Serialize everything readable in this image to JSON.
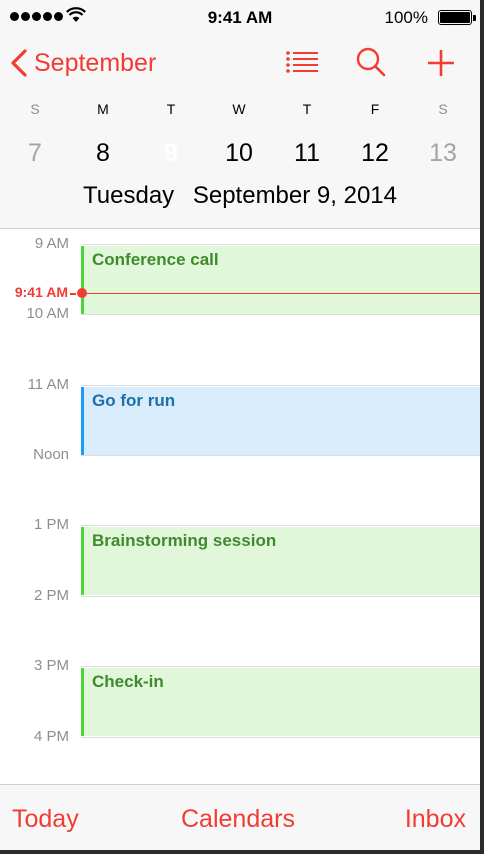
{
  "status_bar": {
    "time": "9:41 AM",
    "battery": "100%"
  },
  "nav": {
    "back_label": "September"
  },
  "week": {
    "weekdays": [
      "S",
      "M",
      "T",
      "W",
      "T",
      "F",
      "S"
    ],
    "dates": [
      "7",
      "8",
      "9",
      "10",
      "11",
      "12",
      "13"
    ],
    "selected_index": 2
  },
  "selected_day": {
    "weekday": "Tuesday",
    "date": "September 9, 2014"
  },
  "timeline": {
    "hours": [
      "9 AM",
      "10 AM",
      "11 AM",
      "Noon",
      "1 PM",
      "2 PM",
      "3 PM",
      "4 PM"
    ],
    "now_label": "9:41 AM",
    "events": [
      {
        "title": "Conference call",
        "color": "green"
      },
      {
        "title": "Go for run",
        "color": "blue"
      },
      {
        "title": "Brainstorming session",
        "color": "green"
      },
      {
        "title": "Check-in",
        "color": "green"
      }
    ]
  },
  "toolbar": {
    "today": "Today",
    "calendars": "Calendars",
    "inbox": "Inbox"
  },
  "colors": {
    "accent": "#f13c34",
    "event_green_bg": "#e1f7d9",
    "event_blue_bg": "#d8ecfb"
  }
}
